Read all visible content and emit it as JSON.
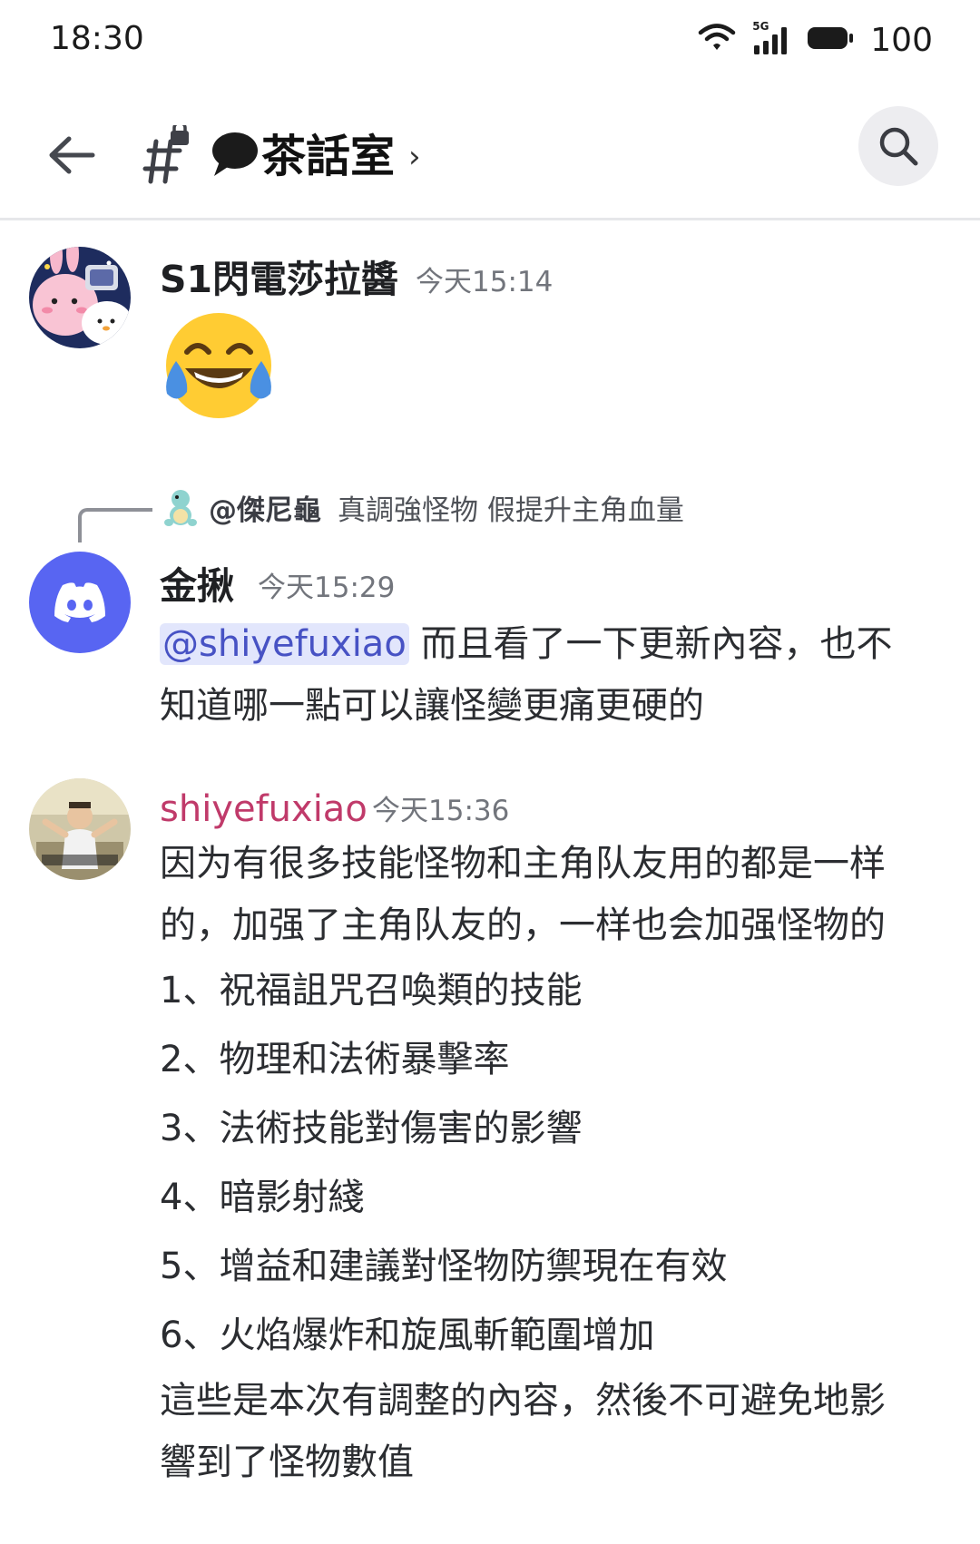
{
  "status_bar": {
    "time": "18:30",
    "network": "5G",
    "battery": "100"
  },
  "header": {
    "channel_name": "茶話室",
    "icons": [
      "back-arrow-icon",
      "locked-hash-icon",
      "speech-bubble-icon",
      "chevron-right-icon",
      "search-icon"
    ]
  },
  "messages": [
    {
      "author": "S1閃電莎拉醬",
      "time": "今天15:14",
      "content_emoji": "joy-tears-emoji"
    },
    {
      "reply": {
        "author": "@傑尼龜",
        "text": "真調強怪物 假提升主角血量"
      },
      "author": "金揪",
      "time": "今天15:29",
      "mention": "@shiyefuxiao",
      "line1": "而且看了一下更新內容，也不",
      "line2": "知道哪一點可以讓怪變更痛更硬的"
    },
    {
      "author": "shiyefuxiao",
      "author_color": "#c03a6a",
      "time": "今天15:36",
      "lines": [
        "因为有很多技能怪物和主角队友用的都是一样",
        "的，加强了主角队友的，一样也会加强怪物的"
      ],
      "list": [
        "1、祝福詛咒召喚類的技能",
        "2、物理和法術暴擊率",
        "3、法術技能對傷害的影響",
        "4、暗影射綫",
        "5、增益和建議對怪物防禦現在有效",
        "6、火焰爆炸和旋風斬範圍增加"
      ],
      "closing": [
        "這些是本次有調整的內容，然後不可避免地影",
        "響到了怪物數值"
      ]
    }
  ],
  "colors": {
    "accent": "#5865f2",
    "mention_bg": "#e2e6fc",
    "mention_text": "#4752c4",
    "shiyefuxiao_name": "#c03a6a"
  }
}
